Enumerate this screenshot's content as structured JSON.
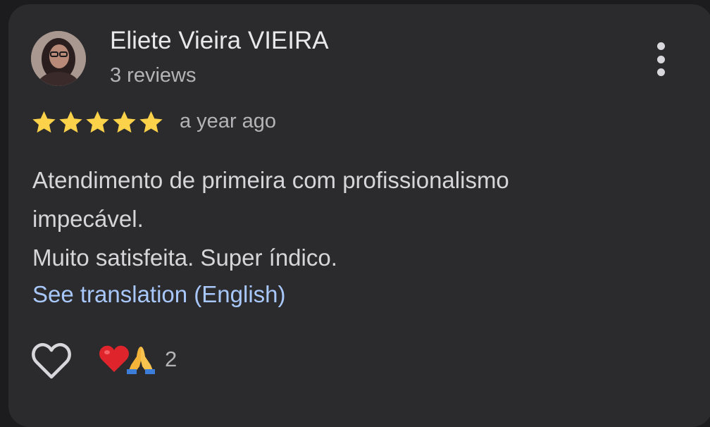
{
  "review": {
    "author_name": "Eliete Vieira VIEIRA",
    "author_reviews": "3 reviews",
    "rating": 5,
    "rating_max": 5,
    "time_ago": "a year ago",
    "text_lines": [
      "Atendimento de primeira com profissionalismo",
      "impecável.",
      "Muito satisfeita. Super índico."
    ],
    "translate_link": "See translation (English)",
    "reactions": {
      "icons": [
        "red-heart-icon",
        "folded-hands-icon"
      ],
      "count": "2"
    }
  },
  "colors": {
    "background": "#1c1c1e",
    "card": "#2b2b2d",
    "star": "#fbd24a",
    "link": "#a8c7fa"
  }
}
